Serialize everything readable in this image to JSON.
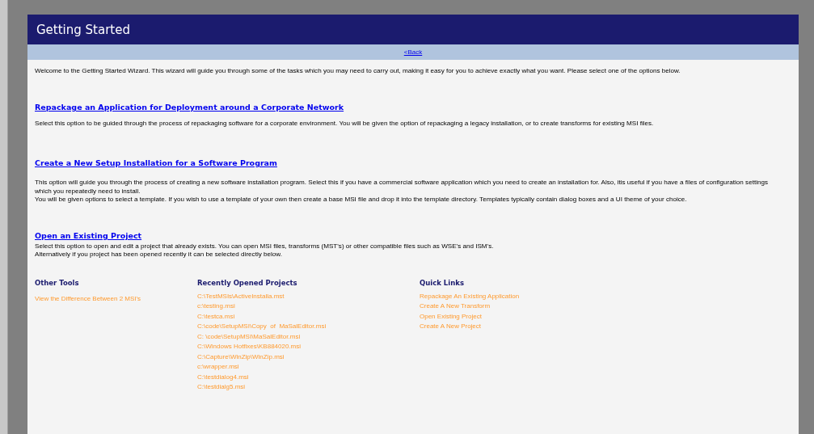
{
  "header": {
    "title": "Getting Started"
  },
  "nav": {
    "back_link": "<Back"
  },
  "intro": "Welcome to the Getting Started Wizard. This wizard will guide you through some of the tasks which you may need to carry out, making it easy for you to achieve exactly what you want. Please select one of the options below.",
  "options": [
    {
      "title": "Repackage an Application for Deployment around a Corporate Network",
      "lines": [
        "Select this option to be guided through the process of repackaging software for a corporate environment. You will be given the option of repackaging a legacy installation, or to create transforms for existing MSI files."
      ]
    },
    {
      "title": "Create a New Setup Installation for a Software Program",
      "lines": [
        "This option will guide you through the process of creating a new software installation program. Select this if you have a commercial software application which you need to create an installation for. Also, itis useful if you have a files of configuration settings which you repeatedly need to install.",
        "You will be given options to select a template. If you wish to use a template of your own then create a base MSI file and drop it into the template directory. Templates typically contain dialog boxes and a UI theme of your choice."
      ]
    },
    {
      "title": "Open an Existing Project",
      "lines": [
        "Select this option to open and edit a project that already exists. You can open MSI files, transforms (MST's) or other compatible files such as WSE's and ISM's.",
        "Alternatively if you project has been opened recently it can be selected directly below."
      ]
    }
  ],
  "link_columns": [
    {
      "heading": "Other Tools",
      "links": [
        "View the Difference Between 2 MSI's"
      ]
    },
    {
      "heading": "Recently Opened Projects",
      "links": [
        "C:\\TestMSIs\\ActiveInstalla.mst",
        "c:\\testing.msi",
        "C:\\testca.msi",
        "C:\\code\\SetupMSI\\Copy  of  MaSalEditor.msi",
        "C: \\code\\SetupMSI\\MaSalEditor.msi",
        "C:\\Windows Hotfixes\\KB884020.msi",
        "C:\\Capture\\WinZip\\WinZip.msi",
        "c:\\wrapper.msi",
        "C:\\testdialog4.msi",
        "C:\\testdialg5.msi"
      ]
    },
    {
      "heading": "Quick Links",
      "links": [
        "Repackage An Existing Application",
        "Create A New Transform",
        "Open Existing Project",
        "Create A New Project"
      ]
    }
  ]
}
